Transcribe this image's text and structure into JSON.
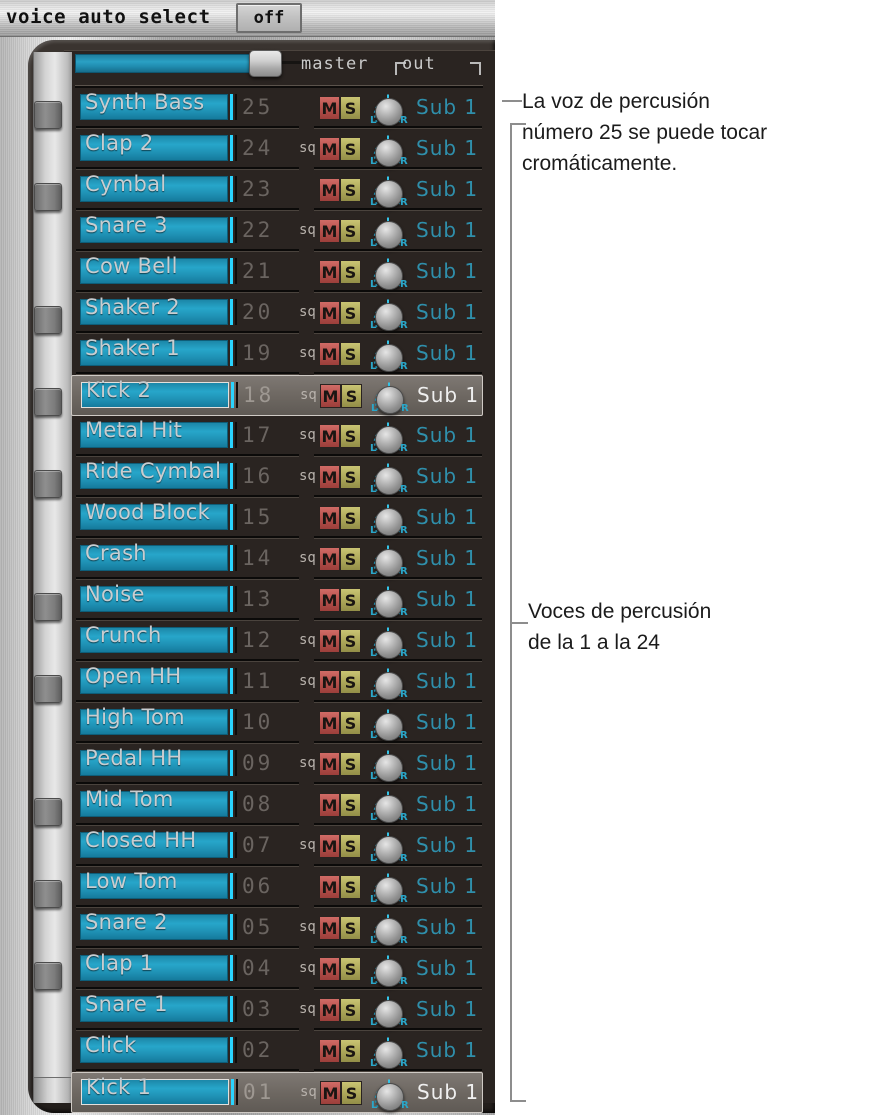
{
  "header": {
    "voice_auto_select_label": "voice auto select",
    "voice_auto_select_value": "off"
  },
  "master": {
    "label": "master",
    "out_label": "out",
    "slider_value": 78
  },
  "colors": {
    "name_field_teal": "#27a6ca",
    "caret_cyan": "#2ad4ff",
    "mute_red": "#b9534e",
    "solo_olive": "#b0ab5c",
    "out_text_teal": "#2f8fab",
    "panel_dark": "#2a2421",
    "selected_row": "#6e6862"
  },
  "labels": {
    "mute": "M",
    "solo": "S",
    "sequencer": "sq",
    "pan_left": "L",
    "pan_right": "R"
  },
  "rows": [
    {
      "name": "Synth Bass",
      "num": "25",
      "sq": false,
      "out": "Sub 1",
      "selected": false,
      "overflow": false
    },
    {
      "name": "Clap 2",
      "num": "24",
      "sq": true,
      "out": "Sub 1",
      "selected": false,
      "overflow": false
    },
    {
      "name": "Cymbal",
      "num": "23",
      "sq": false,
      "out": "Sub 1",
      "selected": false,
      "overflow": false
    },
    {
      "name": "Snare 3",
      "num": "22",
      "sq": true,
      "out": "Sub 1",
      "selected": false,
      "overflow": false
    },
    {
      "name": "Cow Bell",
      "num": "21",
      "sq": false,
      "out": "Sub 1",
      "selected": false,
      "overflow": false
    },
    {
      "name": "Shaker 2",
      "num": "20",
      "sq": true,
      "out": "Sub 1",
      "selected": false,
      "overflow": false
    },
    {
      "name": "Shaker 1",
      "num": "19",
      "sq": true,
      "out": "Sub 1",
      "selected": false,
      "overflow": false
    },
    {
      "name": "Kick 2",
      "num": "18",
      "sq": true,
      "out": "Sub 1",
      "selected": true,
      "overflow": false
    },
    {
      "name": "Metal Hit",
      "num": "17",
      "sq": true,
      "out": "Sub 1",
      "selected": false,
      "overflow": false
    },
    {
      "name": "Ride Cymbal",
      "num": "16",
      "sq": true,
      "out": "Sub 1",
      "selected": false,
      "overflow": true
    },
    {
      "name": "Wood Block",
      "num": "15",
      "sq": false,
      "out": "Sub 1",
      "selected": false,
      "overflow": true
    },
    {
      "name": "Crash",
      "num": "14",
      "sq": true,
      "out": "Sub 1",
      "selected": false,
      "overflow": false
    },
    {
      "name": "Noise",
      "num": "13",
      "sq": false,
      "out": "Sub 1",
      "selected": false,
      "overflow": false
    },
    {
      "name": "Crunch",
      "num": "12",
      "sq": true,
      "out": "Sub 1",
      "selected": false,
      "overflow": false
    },
    {
      "name": "Open HH",
      "num": "11",
      "sq": true,
      "out": "Sub 1",
      "selected": false,
      "overflow": false
    },
    {
      "name": "High Tom",
      "num": "10",
      "sq": false,
      "out": "Sub 1",
      "selected": false,
      "overflow": false
    },
    {
      "name": "Pedal HH",
      "num": "09",
      "sq": true,
      "out": "Sub 1",
      "selected": false,
      "overflow": false
    },
    {
      "name": "Mid Tom",
      "num": "08",
      "sq": false,
      "out": "Sub 1",
      "selected": false,
      "overflow": false
    },
    {
      "name": "Closed HH",
      "num": "07",
      "sq": true,
      "out": "Sub 1",
      "selected": false,
      "overflow": false
    },
    {
      "name": "Low Tom",
      "num": "06",
      "sq": false,
      "out": "Sub 1",
      "selected": false,
      "overflow": false
    },
    {
      "name": "Snare 2",
      "num": "05",
      "sq": true,
      "out": "Sub 1",
      "selected": false,
      "overflow": false
    },
    {
      "name": "Clap 1",
      "num": "04",
      "sq": true,
      "out": "Sub 1",
      "selected": false,
      "overflow": false
    },
    {
      "name": "Snare 1",
      "num": "03",
      "sq": true,
      "out": "Sub 1",
      "selected": false,
      "overflow": false
    },
    {
      "name": "Click",
      "num": "02",
      "sq": false,
      "out": "Sub 1",
      "selected": false,
      "overflow": false
    },
    {
      "name": "Kick 1",
      "num": "01",
      "sq": true,
      "out": "Sub 1",
      "selected": true,
      "overflow": false
    }
  ],
  "annotations": {
    "note_1": "La voz de percusión\nnúmero 25 se puede tocar\ncromáticamente.",
    "note_2": "Voces de percusión\nde la 1 a la 24"
  }
}
